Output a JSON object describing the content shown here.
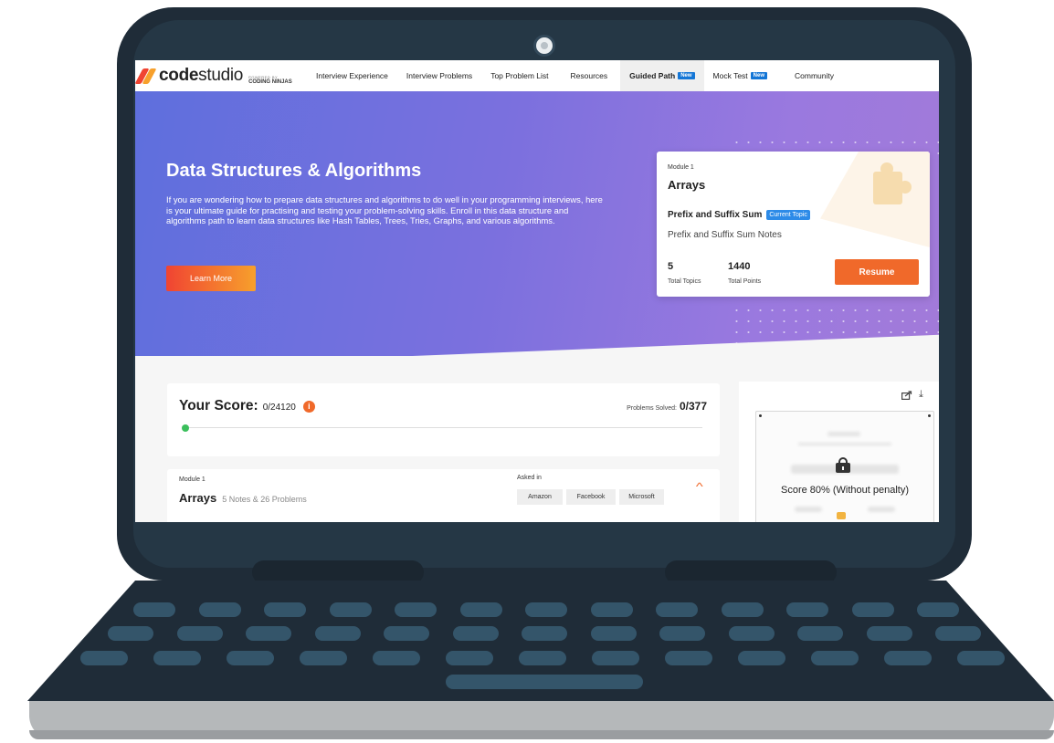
{
  "nav": {
    "brand_bold": "code",
    "brand_light": "studio",
    "powered_by": "POWERED BY",
    "partner": "CODING NINJAS",
    "items": [
      {
        "label": "Interview Experience"
      },
      {
        "label": "Interview Problems"
      },
      {
        "label": "Top Problem List"
      },
      {
        "label": "Resources"
      },
      {
        "label": "Guided Path",
        "badge": "New"
      },
      {
        "label": "Mock Test",
        "badge": "New"
      },
      {
        "label": "Community"
      }
    ]
  },
  "hero": {
    "title": "Data Structures & Algorithms",
    "description": "If you are wondering how to prepare data structures and algorithms to do well in your programming interviews, here is your ultimate guide for practising and testing your problem-solving skills. Enroll in this data structure and algorithms path to learn data structures like Hash Tables, Trees, Tries, Graphs, and various algorithms.",
    "cta": "Learn More"
  },
  "progress_card": {
    "module_label": "Module 1",
    "module_title": "Arrays",
    "topic": "Prefix and Suffix Sum",
    "topic_badge": "Current Topic",
    "notes": "Prefix and Suffix Sum Notes",
    "total_topics_value": "5",
    "total_topics_label": "Total Topics",
    "total_points_value": "1440",
    "total_points_label": "Total Points",
    "resume": "Resume"
  },
  "score": {
    "title": "Your Score:",
    "value": "0/24120",
    "info": "i",
    "solved_label": "Problems Solved:",
    "solved_value": "0/377",
    "progress": 0
  },
  "module": {
    "label": "Module 1",
    "title": "Arrays",
    "count": "5 Notes & 26 Problems",
    "asked_label": "Asked in",
    "companies": [
      "Amazon",
      "Facebook",
      "Microsoft"
    ]
  },
  "certificate": {
    "lock_text": "Score 80% (Without penalty)"
  },
  "colors": {
    "brand_orange": "#f0692a",
    "hero_start": "#5e6fdd",
    "hero_end": "#a27ad9",
    "badge_blue": "#1476d6",
    "progress_green": "#3bbf5c",
    "laptop_body": "#1f2c38"
  }
}
